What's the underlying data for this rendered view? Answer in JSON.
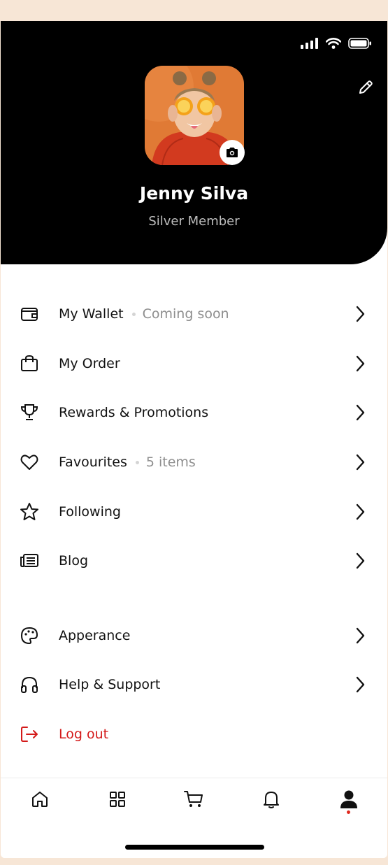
{
  "profile": {
    "name": "Jenny Silva",
    "membership": "Silver Member"
  },
  "menu": {
    "wallet": {
      "label": "My Wallet",
      "sub": "Coming soon"
    },
    "order": {
      "label": "My Order"
    },
    "rewards": {
      "label": "Rewards & Promotions"
    },
    "favourites": {
      "label": "Favourites",
      "sub": "5 items"
    },
    "following": {
      "label": "Following"
    },
    "blog": {
      "label": "Blog"
    },
    "appearance": {
      "label": "Apperance"
    },
    "help": {
      "label": "Help & Support"
    },
    "logout": {
      "label": "Log out"
    }
  },
  "tabbar": {
    "tabs": [
      "home-icon",
      "grid-icon",
      "cart-icon",
      "bell-icon",
      "profile-icon"
    ],
    "active": "profile"
  },
  "colors": {
    "header": "#000000",
    "accent_red": "#d41a1a",
    "background": "#f7e6d6"
  }
}
